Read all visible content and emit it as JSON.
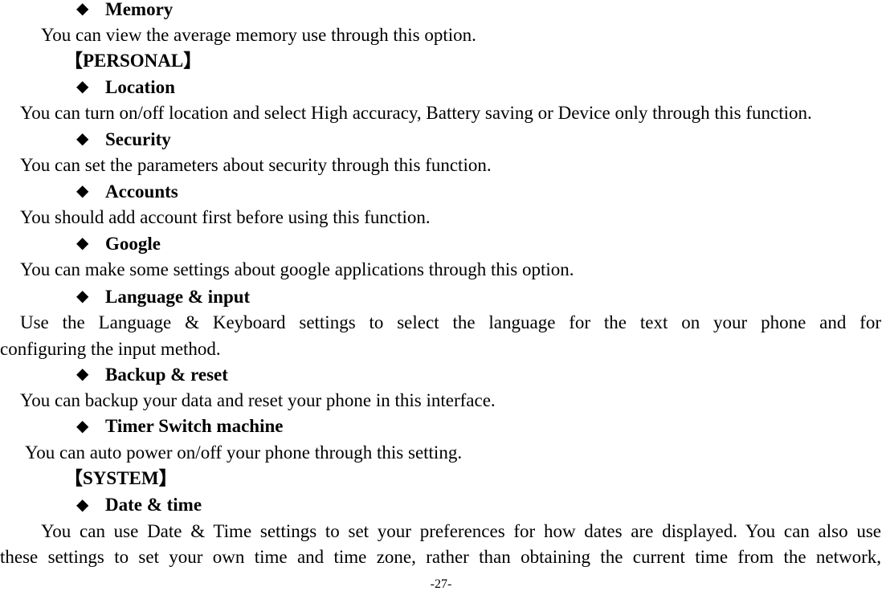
{
  "page": {
    "bullet_glyph": "◆",
    "items": [
      {
        "type": "heading",
        "text": "Memory"
      },
      {
        "type": "body",
        "text": "You can view the average memory use through this option."
      },
      {
        "type": "section",
        "text": "【PERSONAL】"
      },
      {
        "type": "heading",
        "text": "Location"
      },
      {
        "type": "body",
        "text": "You can turn on/off location and select High accuracy, Battery saving or Device only through this function."
      },
      {
        "type": "heading",
        "text": "Security"
      },
      {
        "type": "body",
        "text": "You can set the parameters about security through this function."
      },
      {
        "type": "heading",
        "text": "Accounts"
      },
      {
        "type": "body",
        "text": "You should add account first before using this function."
      },
      {
        "type": "heading",
        "text": "Google"
      },
      {
        "type": "body",
        "text": "You can make some settings about google applications through this option."
      },
      {
        "type": "heading",
        "text": "Language & input"
      },
      {
        "type": "body",
        "text": "Use the Language & Keyboard settings to select the language for the text on your phone and for"
      },
      {
        "type": "body",
        "text": "configuring the input method."
      },
      {
        "type": "heading",
        "text": "Backup & reset"
      },
      {
        "type": "body",
        "text": "You can backup your data and reset your phone in this interface."
      },
      {
        "type": "heading",
        "text": "Timer Switch machine"
      },
      {
        "type": "body",
        "text": "You can auto power on/off your phone through this setting."
      },
      {
        "type": "section",
        "text": "【SYSTEM】"
      },
      {
        "type": "heading",
        "text": "Date & time"
      },
      {
        "type": "body",
        "text": "You can use Date & Time settings to set your preferences for how dates are displayed. You can also use"
      },
      {
        "type": "body",
        "text": "these settings to set your own time and time zone, rather than obtaining the current time from the network,"
      }
    ],
    "page_number": "-27-"
  }
}
